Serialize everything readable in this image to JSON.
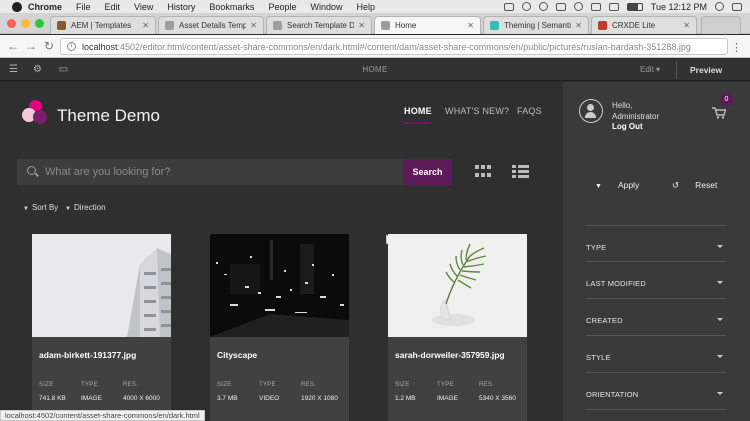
{
  "os_menu": {
    "app": "Chrome",
    "items": [
      "File",
      "Edit",
      "View",
      "History",
      "Bookmarks",
      "People",
      "Window",
      "Help"
    ],
    "clock": "Tue 12:12 PM"
  },
  "tabs": [
    {
      "label": "AEM | Templates",
      "active": false,
      "favicon_color": "#8b5a2b"
    },
    {
      "label": "Asset Details Template",
      "active": false,
      "favicon_color": "#9e9e9e"
    },
    {
      "label": "Search Template Dark",
      "active": false,
      "favicon_color": "#9e9e9e"
    },
    {
      "label": "Home",
      "active": true,
      "favicon_color": "#9e9e9e"
    },
    {
      "label": "Theming | Semantic UI",
      "active": false,
      "favicon_color": "#35bdb2"
    },
    {
      "label": "CRXDE Lite",
      "active": false,
      "favicon_color": "#c0392b"
    }
  ],
  "address": {
    "host": "localhost",
    "path": ":4502/editor.html/content/asset-share-commons/en/dark.html#/content/dam/asset-share-commons/en/public/pictures/ruslan-bardash-351288.jpg"
  },
  "editor": {
    "page_name": "HOME",
    "mode": "Edit",
    "preview_label": "Preview"
  },
  "site": {
    "brand": "Theme Demo",
    "nav": [
      {
        "label": "HOME",
        "active": true
      },
      {
        "label": "WHAT'S NEW?",
        "active": false
      },
      {
        "label": "FAQS",
        "active": false
      }
    ],
    "search": {
      "placeholder": "What are you looking for?",
      "value": "",
      "button": "Search"
    },
    "sort_by": "Sort By",
    "direction": "Direction"
  },
  "result_labels": {
    "size": "SIZE",
    "type": "TYPE",
    "res": "RES."
  },
  "results": [
    {
      "name": "adam-birkett-191377.jpg",
      "size": "741.8 KB",
      "type": "IMAGE",
      "res": "4000 X 6000"
    },
    {
      "name": "Cityscape",
      "size": "3.7 MB",
      "type": "VIDEO",
      "res": "1920 X 1080"
    },
    {
      "name": "sarah-dorweiler-357959.jpg",
      "size": "1.2 MB",
      "type": "IMAGE",
      "res": "5340 X 3560"
    }
  ],
  "sidebar": {
    "greeting": "Hello,",
    "user": "Administrator",
    "logout": "Log Out",
    "cart_count": "0",
    "apply": "Apply",
    "reset": "Reset",
    "filters": [
      "TYPE",
      "LAST MODIFIED",
      "CREATED",
      "STYLE",
      "ORIENTATION"
    ]
  },
  "status_bar": "localhost:4502/content/asset-share-commons/en/dark.html",
  "colors": {
    "accent": "#5c1b58",
    "page_bg": "#2f2f2f",
    "sidebar_bg": "#3a3a3a",
    "card_bg": "#414141"
  }
}
